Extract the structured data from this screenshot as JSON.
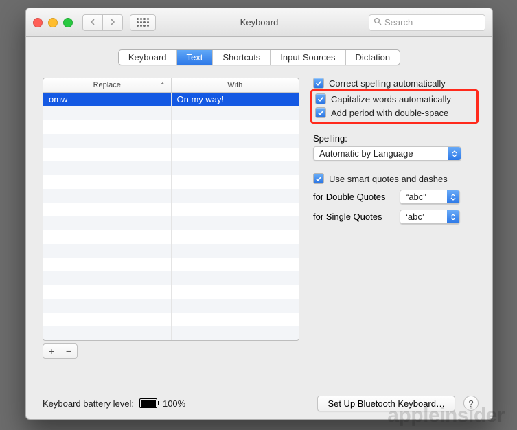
{
  "window": {
    "title": "Keyboard"
  },
  "toolbar": {
    "back_icon": "chevron-left-icon",
    "forward_icon": "chevron-right-icon",
    "apps_icon": "grid-icon",
    "search_placeholder": "Search"
  },
  "tabs": {
    "items": [
      {
        "label": "Keyboard",
        "selected": false
      },
      {
        "label": "Text",
        "selected": true
      },
      {
        "label": "Shortcuts",
        "selected": false
      },
      {
        "label": "Input Sources",
        "selected": false
      },
      {
        "label": "Dictation",
        "selected": false
      }
    ]
  },
  "table": {
    "columns": {
      "replace": "Replace",
      "with": "With"
    },
    "sort_column": "replace",
    "rows": [
      {
        "replace": "omw",
        "with": "On my way!",
        "selected": true
      }
    ],
    "add_label": "+",
    "remove_label": "−"
  },
  "options": {
    "correct_spelling": {
      "label": "Correct spelling automatically",
      "checked": true
    },
    "capitalize_words": {
      "label": "Capitalize words automatically",
      "checked": true
    },
    "add_period": {
      "label": "Add period with double-space",
      "checked": true
    },
    "spelling_section": "Spelling:",
    "spelling_value": "Automatic by Language",
    "smart_quotes": {
      "label": "Use smart quotes and dashes",
      "checked": true
    },
    "double_quotes_label": "for Double Quotes",
    "double_quotes_value": "“abc”",
    "single_quotes_label": "for Single Quotes",
    "single_quotes_value": "‘abc’"
  },
  "footer": {
    "battery_label": "Keyboard battery level:",
    "battery_percent": "100%",
    "bluetooth_button": "Set Up Bluetooth Keyboard…",
    "help_icon": "?"
  },
  "watermark": "appleinsider"
}
